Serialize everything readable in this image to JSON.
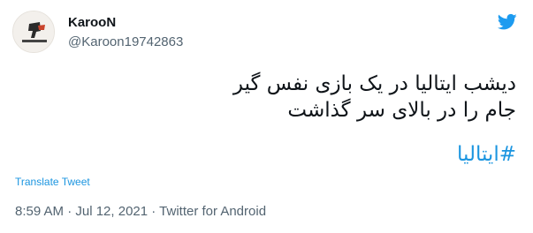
{
  "author": {
    "display_name": "KarooN",
    "handle": "@Karoon19742863",
    "avatar_icon": "profile-avatar-icon"
  },
  "platform_icon": "twitter-bird-icon",
  "colors": {
    "link": "#1b95e0",
    "secondary_text": "#536471",
    "primary_text": "#0f1419",
    "twitter_blue": "#1d9bf0"
  },
  "tweet": {
    "lines": [
      "دیشب ایتالیا در یک بازی نفس گیر",
      "جام را در بالای سر گذاشت"
    ],
    "hashtag": "#ایتالیا"
  },
  "actions": {
    "translate_label": "Translate Tweet"
  },
  "meta": {
    "timestamp": "8:59 AM · Jul 12, 2021 · Twitter for Android"
  }
}
